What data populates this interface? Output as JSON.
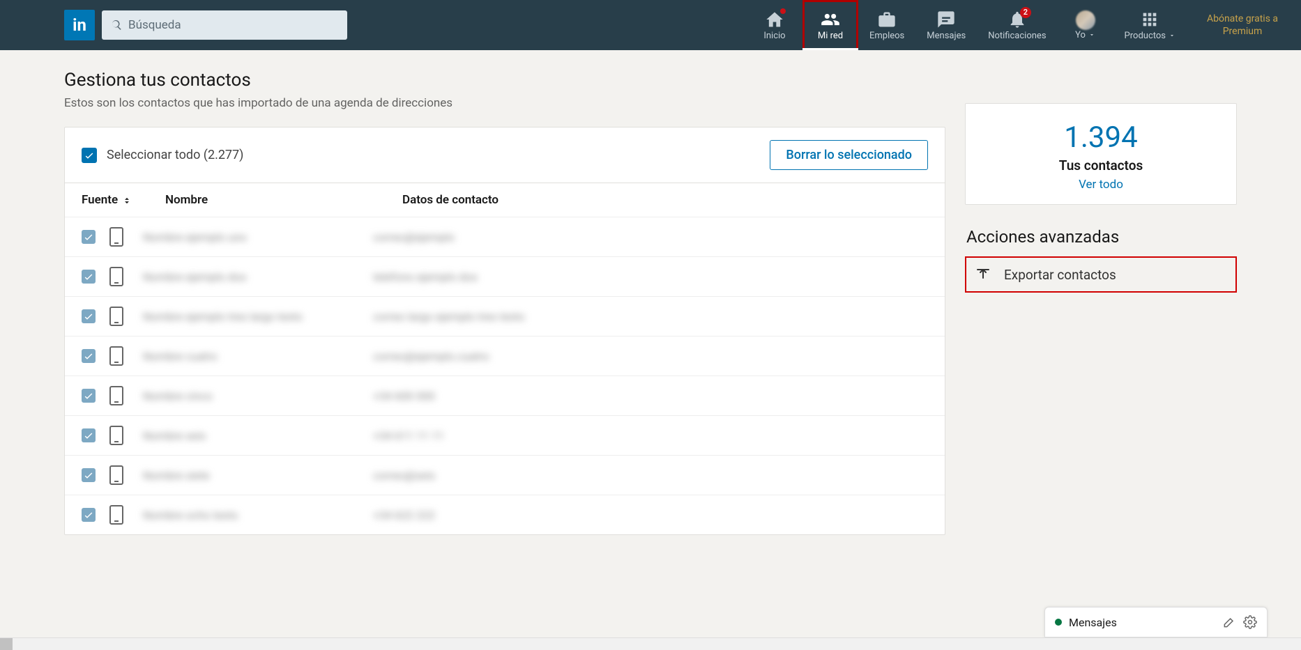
{
  "nav": {
    "search_placeholder": "Búsqueda",
    "items": [
      {
        "label": "Inicio",
        "icon": "home",
        "badge": "dot"
      },
      {
        "label": "Mi red",
        "icon": "people",
        "active": true,
        "highlighted": true
      },
      {
        "label": "Empleos",
        "icon": "briefcase"
      },
      {
        "label": "Mensajes",
        "icon": "messages"
      },
      {
        "label": "Notificaciones",
        "icon": "bell",
        "badge": "2"
      },
      {
        "label": "Yo",
        "icon": "avatar",
        "dropdown": true
      },
      {
        "label": "Productos",
        "icon": "grid",
        "dropdown": true
      }
    ],
    "premium_text": "Abónate gratis a Premium"
  },
  "page": {
    "title": "Gestiona tus contactos",
    "subtitle": "Estos son los contactos que has importado de una agenda de direcciones"
  },
  "contacts_panel": {
    "select_all_label": "Seleccionar todo (2.277)",
    "delete_button": "Borrar lo seleccionado",
    "columns": {
      "fuente": "Fuente",
      "nombre": "Nombre",
      "datos": "Datos de contacto"
    },
    "rows": [
      {
        "name_placeholder": "Nombre ejemplo uno",
        "data_placeholder": "correo@ejemplo"
      },
      {
        "name_placeholder": "Nombre ejemplo dos",
        "data_placeholder": "telefono ejemplo dos"
      },
      {
        "name_placeholder": "Nombre ejemplo tres largo texto",
        "data_placeholder": "correo largo ejemplo tres texto"
      },
      {
        "name_placeholder": "Nombre cuatro",
        "data_placeholder": "correo@ejemplo.cuatro"
      },
      {
        "name_placeholder": "Nombre cinco",
        "data_placeholder": "+34 600 000"
      },
      {
        "name_placeholder": "Nombre seis",
        "data_placeholder": "+34 611 11 11"
      },
      {
        "name_placeholder": "Nombre siete",
        "data_placeholder": "correo@seis"
      },
      {
        "name_placeholder": "Nombre ocho texto",
        "data_placeholder": "+34 622 222"
      }
    ]
  },
  "sidebar": {
    "count": "1.394",
    "count_label": "Tus contactos",
    "view_all": "Ver todo",
    "advanced_title": "Acciones avanzadas",
    "export_label": "Exportar contactos"
  },
  "messaging": {
    "label": "Mensajes"
  }
}
